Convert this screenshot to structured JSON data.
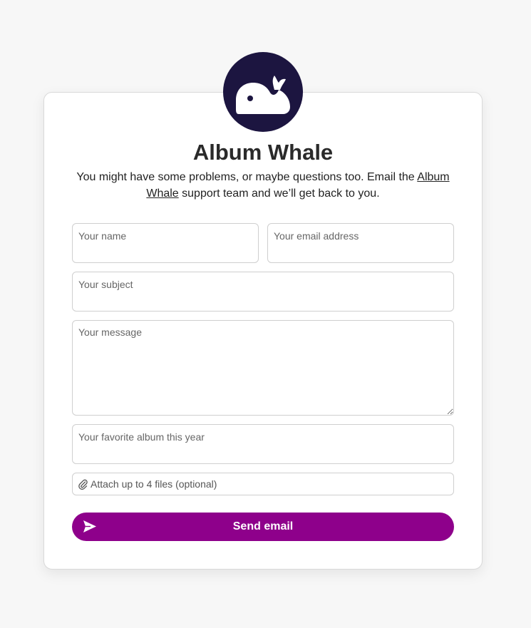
{
  "brand": {
    "name": "Album Whale",
    "logo_icon": "whale-icon",
    "logo_color": "#1c1540"
  },
  "intro": {
    "text_before": "You might have some problems, or maybe questions too. Email the ",
    "link_text": "Album Whale",
    "text_after": " support team and we’ll get back to you."
  },
  "form": {
    "name_placeholder": "Your name",
    "email_placeholder": "Your email address",
    "subject_placeholder": "Your subject",
    "message_placeholder": "Your message",
    "album_placeholder": "Your favorite album this year",
    "attach_label": "Attach up to 4 files (optional)",
    "attach_icon": "paperclip-icon",
    "send_label": "Send email",
    "send_icon": "paper-plane-icon",
    "accent_color": "#8e008b"
  }
}
